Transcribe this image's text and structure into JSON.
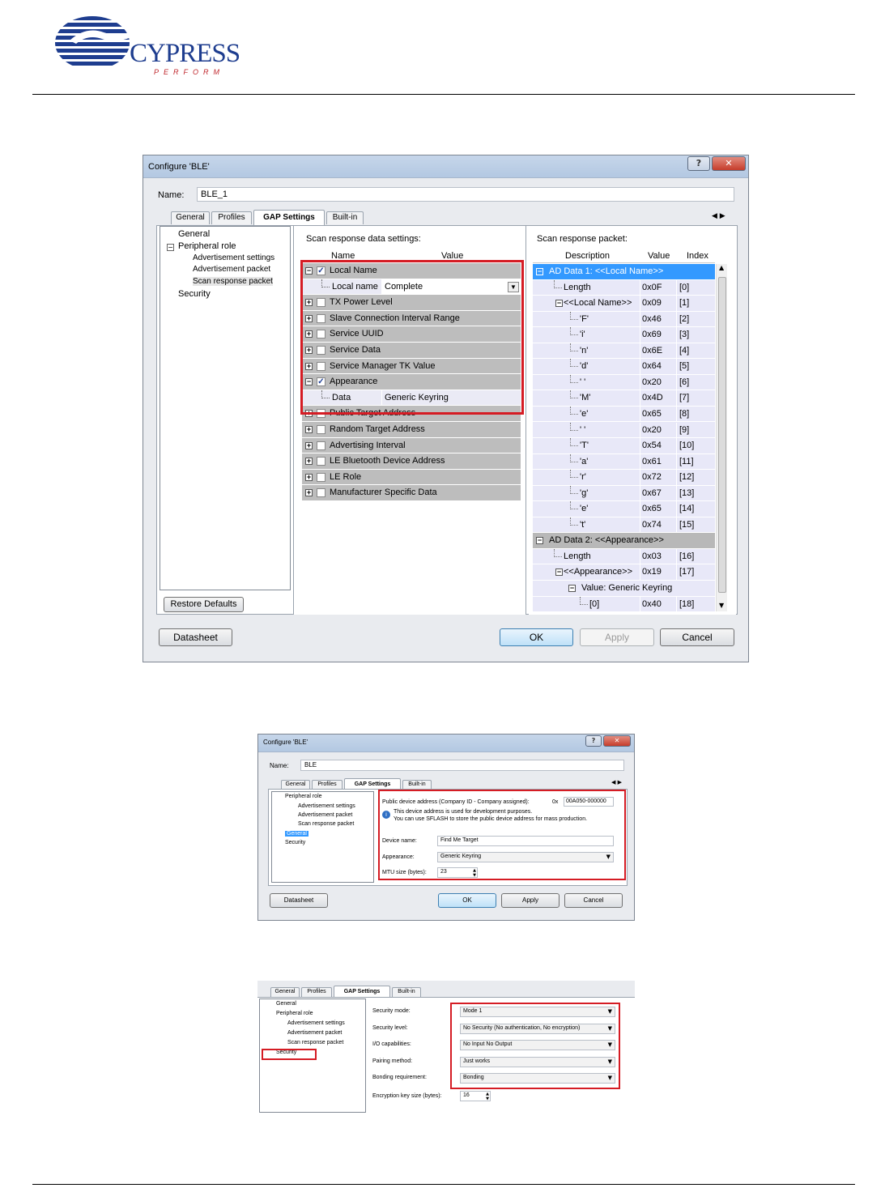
{
  "logo": {
    "wordmark": "CYPRESS",
    "tagline": "PERFORM"
  },
  "dialog1": {
    "title": "Configure 'BLE'",
    "name_label": "Name:",
    "name_value": "BLE_1",
    "tabs": [
      "General",
      "Profiles",
      "GAP Settings",
      "Built-in"
    ],
    "active_tab": "GAP Settings",
    "tree": [
      "General",
      "Peripheral role",
      "Advertisement settings",
      "Advertisement packet",
      "Scan response packet",
      "Security"
    ],
    "restore_defaults": "Restore Defaults",
    "left_heading": "Scan response data settings:",
    "left_columns": [
      "Name",
      "Value"
    ],
    "settings_rows": [
      {
        "name": "Local Name",
        "checked": true,
        "expanded": true
      },
      {
        "name": "Local name",
        "value": "Complete",
        "child": true
      },
      {
        "name": "TX Power Level",
        "checked": false
      },
      {
        "name": "Slave Connection Interval Range",
        "checked": false
      },
      {
        "name": "Service UUID",
        "checked": false
      },
      {
        "name": "Service Data",
        "checked": false
      },
      {
        "name": "Service Manager TK Value",
        "checked": false
      },
      {
        "name": "Appearance",
        "checked": true,
        "expanded": true
      },
      {
        "name": "Data",
        "value": "Generic Keyring",
        "child": true
      },
      {
        "name": "Public Target Address",
        "checked": false
      },
      {
        "name": "Random Target Address",
        "checked": false
      },
      {
        "name": "Advertising Interval",
        "checked": false
      },
      {
        "name": "LE Bluetooth Device Address",
        "checked": false
      },
      {
        "name": "LE Role",
        "checked": false
      },
      {
        "name": "Manufacturer Specific Data",
        "checked": false
      }
    ],
    "right_heading": "Scan response packet:",
    "right_columns": [
      "Description",
      "Value",
      "Index"
    ],
    "packet_rows": [
      {
        "desc": "AD Data 1: <<Local Name>>",
        "type": "header1"
      },
      {
        "desc": "Length",
        "value": "0x0F",
        "index": "[0]"
      },
      {
        "desc": "<<Local Name>>",
        "value": "0x09",
        "index": "[1]"
      },
      {
        "desc": "'F'",
        "value": "0x46",
        "index": "[2]"
      },
      {
        "desc": "'i'",
        "value": "0x69",
        "index": "[3]"
      },
      {
        "desc": "'n'",
        "value": "0x6E",
        "index": "[4]"
      },
      {
        "desc": "'d'",
        "value": "0x64",
        "index": "[5]"
      },
      {
        "desc": "' '",
        "value": "0x20",
        "index": "[6]"
      },
      {
        "desc": "'M'",
        "value": "0x4D",
        "index": "[7]"
      },
      {
        "desc": "'e'",
        "value": "0x65",
        "index": "[8]"
      },
      {
        "desc": "' '",
        "value": "0x20",
        "index": "[9]"
      },
      {
        "desc": "'T'",
        "value": "0x54",
        "index": "[10]"
      },
      {
        "desc": "'a'",
        "value": "0x61",
        "index": "[11]"
      },
      {
        "desc": "'r'",
        "value": "0x72",
        "index": "[12]"
      },
      {
        "desc": "'g'",
        "value": "0x67",
        "index": "[13]"
      },
      {
        "desc": "'e'",
        "value": "0x65",
        "index": "[14]"
      },
      {
        "desc": "'t'",
        "value": "0x74",
        "index": "[15]"
      },
      {
        "desc": "AD Data 2: <<Appearance>>",
        "type": "header2"
      },
      {
        "desc": "Length",
        "value": "0x03",
        "index": "[16]"
      },
      {
        "desc": "<<Appearance>>",
        "value": "0x19",
        "index": "[17]"
      },
      {
        "desc": "Value: Generic Keyring",
        "type": "span"
      },
      {
        "desc": "[0]",
        "value": "0x40",
        "index": "[18]"
      }
    ],
    "buttons": {
      "datasheet": "Datasheet",
      "ok": "OK",
      "apply": "Apply",
      "cancel": "Cancel"
    }
  },
  "dialog2": {
    "title": "Configure 'BLE'",
    "name_label": "Name:",
    "name_value": "BLE",
    "tabs": [
      "General",
      "Profiles",
      "GAP Settings",
      "Built-in"
    ],
    "tree": [
      "Peripheral role",
      "Advertisement settings",
      "Advertisement packet",
      "Scan response packet",
      "General",
      "Security"
    ],
    "public_address_label": "Public device address (Company ID - Company assigned):",
    "public_address_prefix": "0x",
    "public_address_value": "00A050-000000",
    "info_line1": "This device address is used for development purposes.",
    "info_line2": "You can use SFLASH to store the public device address for mass production.",
    "device_name_label": "Device name:",
    "device_name_value": "Find Me Target",
    "appearance_label": "Appearance:",
    "appearance_value": "Generic Keyring",
    "mtu_label": "MTU size (bytes):",
    "mtu_value": "23",
    "buttons": {
      "datasheet": "Datasheet",
      "ok": "OK",
      "apply": "Apply",
      "cancel": "Cancel"
    }
  },
  "dialog3": {
    "tabs": [
      "General",
      "Profiles",
      "GAP Settings",
      "Built-in"
    ],
    "tree": [
      "General",
      "Peripheral role",
      "Advertisement settings",
      "Advertisement packet",
      "Scan response packet",
      "Security"
    ],
    "fields": [
      {
        "label": "Security mode:",
        "value": "Mode 1"
      },
      {
        "label": "Security level:",
        "value": "No Security (No authentication, No encryption)"
      },
      {
        "label": "I/O capabilities:",
        "value": "No Input No Output"
      },
      {
        "label": "Pairing method:",
        "value": "Just works"
      },
      {
        "label": "Bonding requirement:",
        "value": "Bonding"
      }
    ],
    "key_size_label": "Encryption key size (bytes):",
    "key_size_value": "16"
  },
  "colors": {
    "accent_red": "#d51c24",
    "selection_blue": "#3399ff",
    "cypress_blue": "#1e3d8f"
  }
}
